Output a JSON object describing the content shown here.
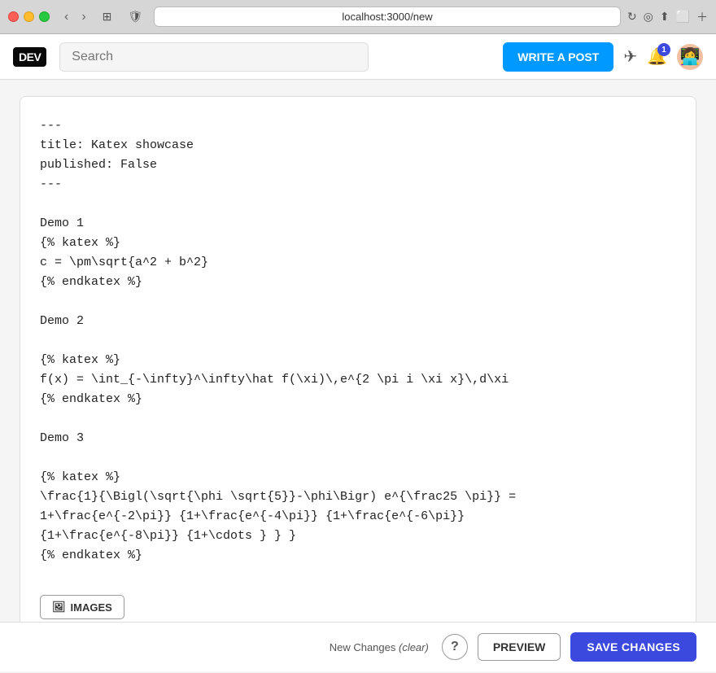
{
  "browser": {
    "url": "localhost:3000/new",
    "back_btn": "‹",
    "forward_btn": "›"
  },
  "navbar": {
    "logo": "DEV",
    "search_placeholder": "Search",
    "write_post_label": "WRITE A POST",
    "notification_count": "1"
  },
  "editor": {
    "content": "---\ntitle: Katex showcase\npublished: False\n---\n\nDemo 1\n{% katex %}\nc = \\pm\\sqrt{a^2 + b^2}\n{% endkatex %}\n\nDemo 2\n\n{% katex %}\nf(x) = \\int_{-\\infty}^\\infty\\hat f(\\xi)\\,e^{2 \\pi i \\xi x}\\,d\\xi\n{% endkatex %}\n\nDemo 3\n\n{% katex %}\n\\frac{1}{\\Bigl(\\sqrt{\\phi \\sqrt{5}}-\\phi\\Bigr) e^{\\frac25 \\pi}} =\n1+\\frac{e^{-2\\pi}} {1+\\frac{e^{-4\\pi}} {1+\\frac{e^{-6\\pi}}\n{1+\\frac{e^{-8\\pi}} {1+\\cdots } } }\n{% endkatex %}",
    "images_btn_label": "IMAGES",
    "images_icon": "🖼"
  },
  "bottom_bar": {
    "new_changes_label": "New Changes",
    "clear_label": "(clear)",
    "help_label": "?",
    "preview_label": "PREVIEW",
    "save_label": "SAVE CHANGES"
  }
}
